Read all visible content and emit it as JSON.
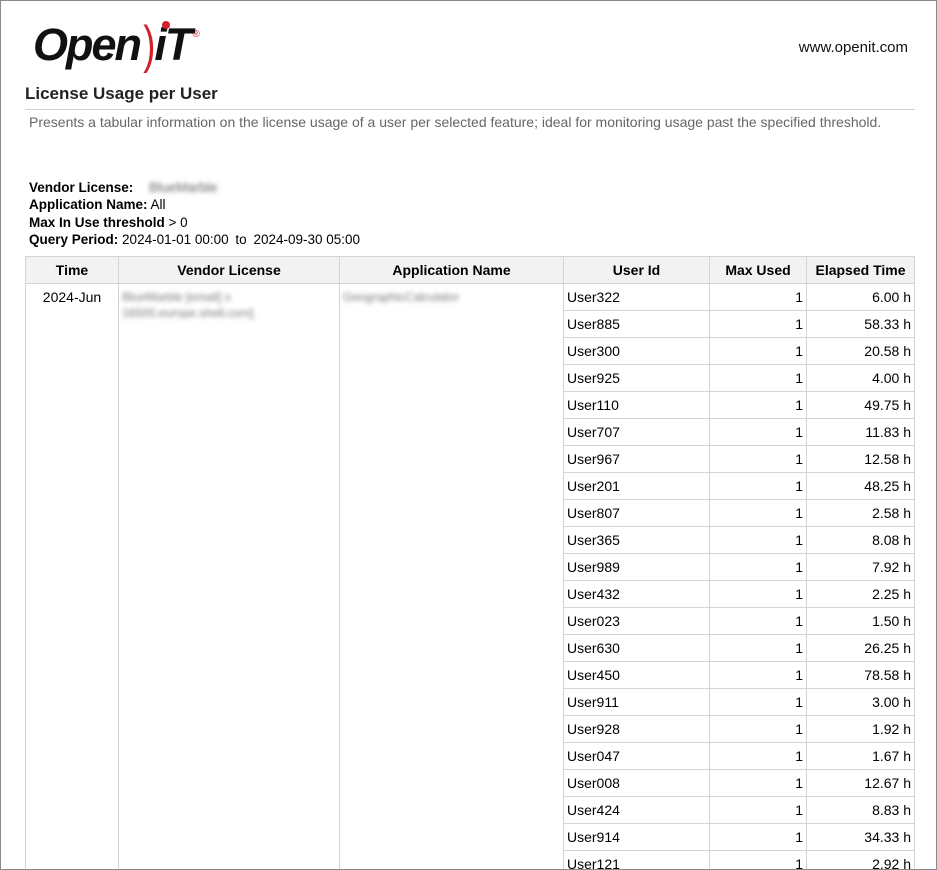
{
  "header": {
    "logo_text_open": "Open",
    "logo_text_it": "iT",
    "logo_reg": "®",
    "site_url": "www.openit.com"
  },
  "report": {
    "title": "License Usage per User",
    "description": "Presents a tabular information on the license usage of a user per selected feature; ideal for monitoring usage past the specified threshold."
  },
  "meta": {
    "vendor_license_label": "Vendor License:",
    "vendor_license_value": "BlueMarble",
    "application_name_label": "Application Name:",
    "application_name_value": "All",
    "max_in_use_label": "Max In Use threshold",
    "max_in_use_value": "> 0",
    "query_period_label": "Query Period:",
    "query_period_start": "2024-01-01 00:00",
    "query_period_to": "to",
    "query_period_end": "2024-09-30 05:00"
  },
  "table": {
    "headers": [
      "Time",
      "Vendor License",
      "Application Name",
      "User Id",
      "Max Used",
      "Elapsed Time"
    ],
    "group": {
      "time": "2024-Jun",
      "vendor_license": "BlueMarble [email] x 16500.europe.shell.com]",
      "application_name": "GeographicCalculator"
    },
    "rows": [
      {
        "user": "User322",
        "max_used": "1",
        "elapsed": "6.00 h"
      },
      {
        "user": "User885",
        "max_used": "1",
        "elapsed": "58.33 h"
      },
      {
        "user": "User300",
        "max_used": "1",
        "elapsed": "20.58 h"
      },
      {
        "user": "User925",
        "max_used": "1",
        "elapsed": "4.00 h"
      },
      {
        "user": "User110",
        "max_used": "1",
        "elapsed": "49.75 h"
      },
      {
        "user": "User707",
        "max_used": "1",
        "elapsed": "11.83 h"
      },
      {
        "user": "User967",
        "max_used": "1",
        "elapsed": "12.58 h"
      },
      {
        "user": "User201",
        "max_used": "1",
        "elapsed": "48.25 h"
      },
      {
        "user": "User807",
        "max_used": "1",
        "elapsed": "2.58 h"
      },
      {
        "user": "User365",
        "max_used": "1",
        "elapsed": "8.08 h"
      },
      {
        "user": "User989",
        "max_used": "1",
        "elapsed": "7.92 h"
      },
      {
        "user": "User432",
        "max_used": "1",
        "elapsed": "2.25 h"
      },
      {
        "user": "User023",
        "max_used": "1",
        "elapsed": "1.50 h"
      },
      {
        "user": "User630",
        "max_used": "1",
        "elapsed": "26.25 h"
      },
      {
        "user": "User450",
        "max_used": "1",
        "elapsed": "78.58 h"
      },
      {
        "user": "User911",
        "max_used": "1",
        "elapsed": "3.00 h"
      },
      {
        "user": "User928",
        "max_used": "1",
        "elapsed": "1.92 h"
      },
      {
        "user": "User047",
        "max_used": "1",
        "elapsed": "1.67 h"
      },
      {
        "user": "User008",
        "max_used": "1",
        "elapsed": "12.67 h"
      },
      {
        "user": "User424",
        "max_used": "1",
        "elapsed": "8.83 h"
      },
      {
        "user": "User914",
        "max_used": "1",
        "elapsed": "34.33 h"
      },
      {
        "user": "User121",
        "max_used": "1",
        "elapsed": "2.92 h"
      }
    ]
  }
}
